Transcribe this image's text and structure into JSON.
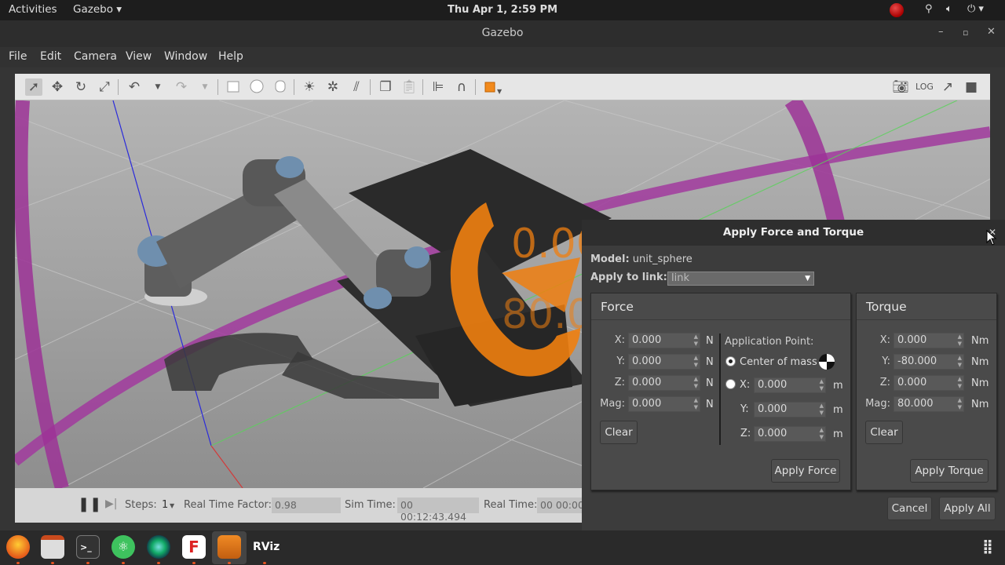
{
  "topbar": {
    "activities": "Activities",
    "app_menu": "Gazebo ▾",
    "clock": "Thu Apr  1,  2:59 PM",
    "tray_icons": [
      "record-icon",
      "network-icon",
      "volume-icon",
      "power-icon"
    ]
  },
  "window": {
    "title": "Gazebo"
  },
  "menu": {
    "items": [
      "File",
      "Edit",
      "Camera",
      "View",
      "Window",
      "Help"
    ]
  },
  "toolbar": {
    "tools": [
      "select-arrow-icon",
      "translate-icon",
      "rotate-icon",
      "scale-icon",
      "undo-icon",
      "redo-icon",
      "box-icon",
      "sphere-icon",
      "cylinder-icon",
      "point-light-icon",
      "spot-light-icon",
      "directional-light-icon",
      "copy-icon",
      "paste-icon",
      "align-icon",
      "snap-icon",
      "view-angle-icon",
      "screenshot-icon",
      "log-icon",
      "plot-icon",
      "video-icon"
    ]
  },
  "scene": {
    "overlay_text_1": "0.00",
    "overlay_text_2": "80.00"
  },
  "bottombar": {
    "steps_label": "Steps:",
    "steps_value": "1",
    "rtf_label": "Real Time Factor:",
    "rtf_value": "0.98",
    "sim_time_label": "Sim Time:",
    "sim_time_value": "00 00:12:43.494",
    "real_time_label": "Real Time:",
    "real_time_value": "00 00:00"
  },
  "dialog": {
    "title": "Apply Force and Torque",
    "model_label": "Model:",
    "model_value": "unit_sphere",
    "link_label": "Apply to link:",
    "link_value": "link",
    "force": {
      "title": "Force",
      "x_label": "X:",
      "x": "0.000",
      "y_label": "Y:",
      "y": "0.000",
      "z_label": "Z:",
      "z": "0.000",
      "mag_label": "Mag:",
      "mag": "0.000",
      "unit": "N",
      "clear": "Clear",
      "app_point_label": "Application Point:",
      "center_of_mass": "Center of mass",
      "px_label": "X:",
      "px": "0.000",
      "py_label": "Y:",
      "py": "0.000",
      "pz_label": "Z:",
      "pz": "0.000",
      "point_unit": "m",
      "apply": "Apply Force"
    },
    "torque": {
      "title": "Torque",
      "x_label": "X:",
      "x": "0.000",
      "y_label": "Y:",
      "y": "-80.000",
      "z_label": "Z:",
      "z": "0.000",
      "mag_label": "Mag:",
      "mag": "80.000",
      "unit": "Nm",
      "clear": "Clear",
      "apply": "Apply Torque"
    },
    "cancel": "Cancel",
    "apply_all": "Apply All"
  },
  "dock": {
    "apps": [
      "firefox-icon",
      "files-icon",
      "terminal-icon",
      "atom-icon",
      "system-monitor-icon",
      "fiji-icon",
      "gazebo-icon",
      "rviz-icon"
    ],
    "rviz_label": "RViz",
    "fiji_label": "F"
  }
}
